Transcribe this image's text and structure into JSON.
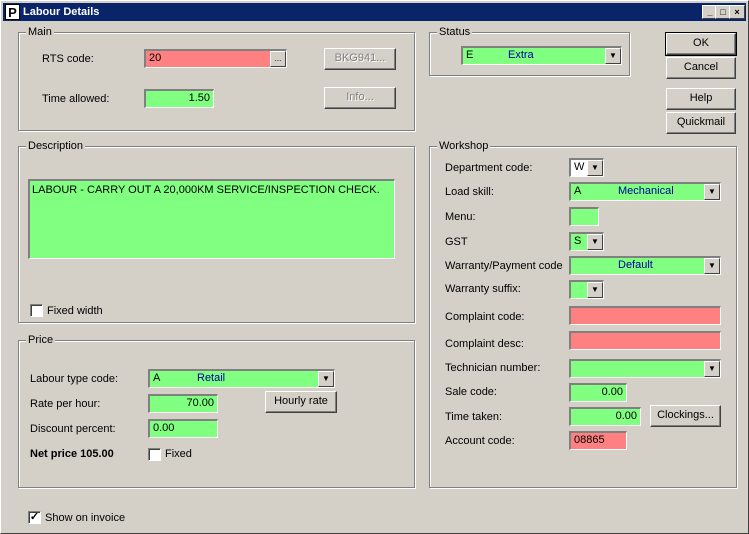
{
  "window": {
    "title": "Labour Details",
    "icon_letter": "P"
  },
  "main": {
    "label": "Main",
    "rts_code_label": "RTS code:",
    "rts_code_value": "20",
    "time_allowed_label": "Time allowed:",
    "time_allowed_value": "1.50",
    "bkg_button": "BKG941...",
    "info_button": "Info..."
  },
  "status": {
    "label": "Status",
    "code": "E",
    "desc": "Extra"
  },
  "buttons": {
    "ok": "OK",
    "cancel": "Cancel",
    "help": "Help",
    "quickmail": "Quickmail"
  },
  "description": {
    "label": "Description",
    "text": "LABOUR - CARRY OUT A 20,000KM SERVICE/INSPECTION CHECK.",
    "fixed_width_label": "Fixed width"
  },
  "price": {
    "label": "Price",
    "labour_type_label": "Labour type code:",
    "labour_type_code": "A",
    "labour_type_desc": "Retail",
    "rate_label": "Rate per hour:",
    "rate_value": "70.00",
    "hourly_rate_button": "Hourly rate",
    "discount_label": "Discount percent:",
    "discount_value": "0.00",
    "net_price": "Net price 105.00",
    "fixed_label": "Fixed"
  },
  "workshop": {
    "label": "Workshop",
    "department_label": "Department code:",
    "department_value": "W",
    "load_skill_label": "Load skill:",
    "load_skill_code": "A",
    "load_skill_desc": "Mechanical",
    "menu_label": "Menu:",
    "menu_value": "",
    "gst_label": "GST",
    "gst_value": "S",
    "warranty_code_label": "Warranty/Payment code",
    "warranty_code_value": "Default",
    "warranty_suffix_label": "Warranty suffix:",
    "warranty_suffix_value": "",
    "complaint_code_label": "Complaint code:",
    "complaint_code_value": "",
    "complaint_desc_label": "Complaint desc:",
    "complaint_desc_value": "",
    "technician_label": "Technician number:",
    "technician_value": "",
    "sale_code_label": "Sale code:",
    "sale_code_value": "0.00",
    "time_taken_label": "Time taken:",
    "time_taken_value": "0.00",
    "clockings_button": "Clockings...",
    "account_code_label": "Account code:",
    "account_code_value": "08865"
  },
  "footer": {
    "show_on_invoice_label": "Show on invoice",
    "show_on_invoice_checked": "✓"
  },
  "icons": {
    "ellipsis": "...",
    "dropdown": "▼",
    "minimize": "_",
    "maximize": "□",
    "close": "×"
  },
  "colors": {
    "required": "#80ff80",
    "error": "#ff8080",
    "titlebar": "#0a246a"
  }
}
